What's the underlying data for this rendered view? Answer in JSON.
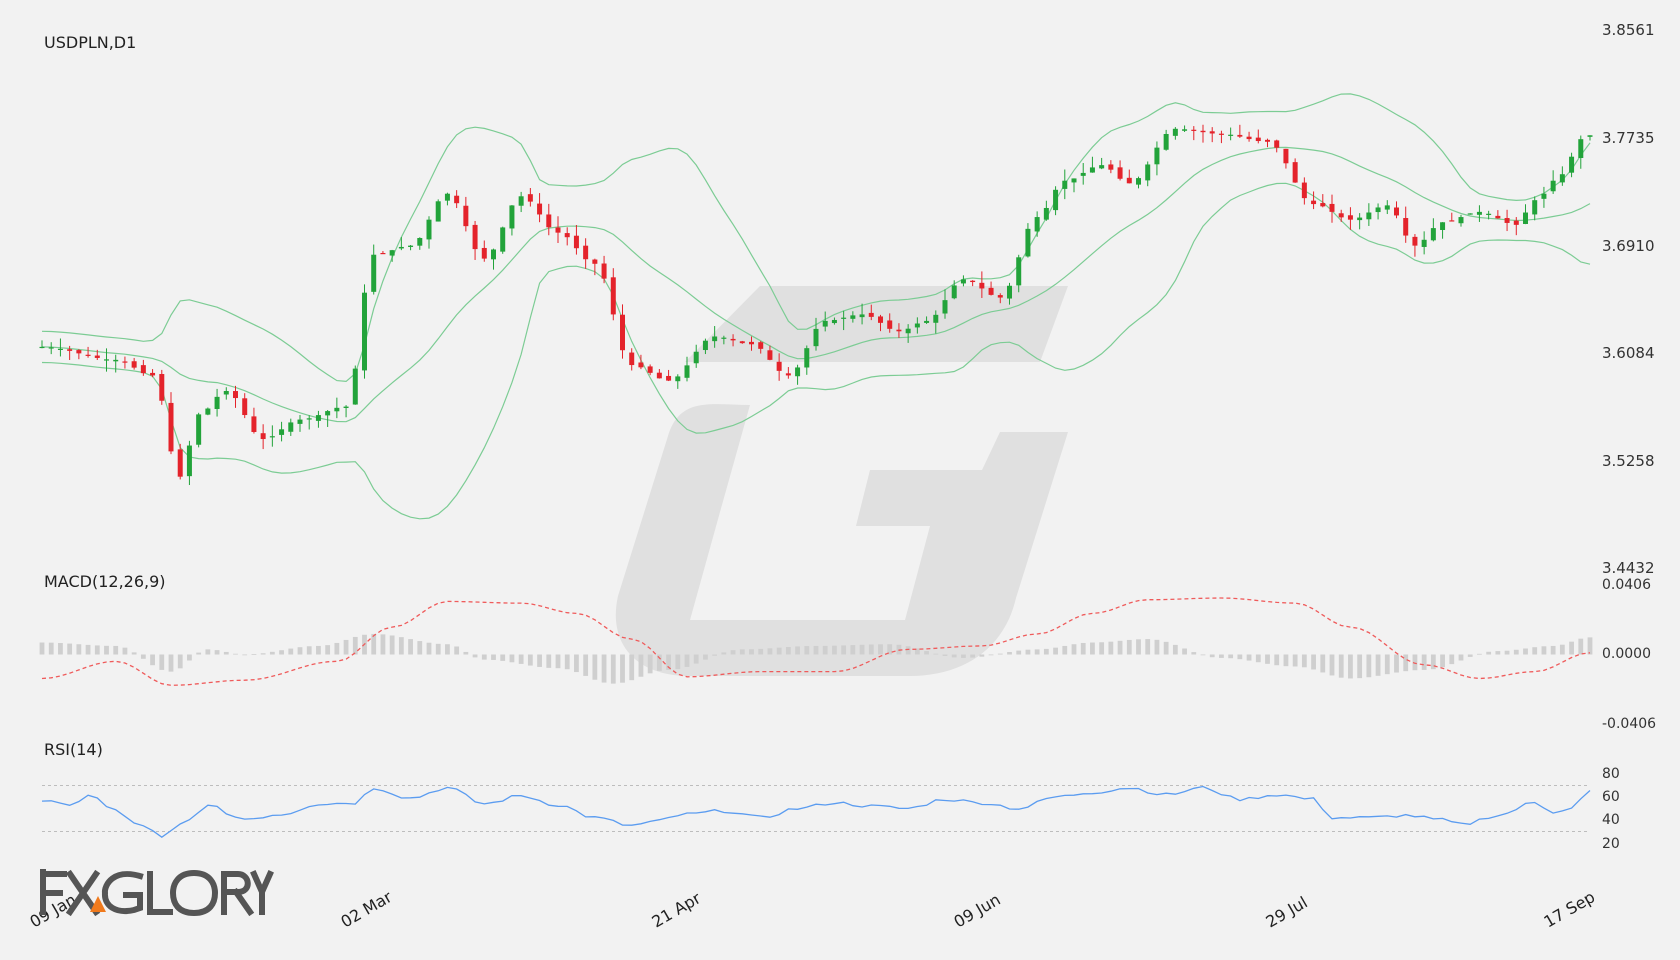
{
  "chart_data": [
    {
      "type": "candlestick",
      "title": "USDPLN,D1",
      "yticks": [
        "3.8561",
        "3.7735",
        "3.6910",
        "3.6084",
        "3.5258",
        "3.4432"
      ],
      "ylim": [
        3.4432,
        3.8561
      ],
      "x_tick_labels": [
        "09 Jan",
        "02 Mar",
        "21 Apr",
        "09 Jun",
        "29 Jul",
        "17 Sep"
      ],
      "indicators": [
        "Bollinger Bands"
      ],
      "anchors": [
        [
          0,
          3.612
        ],
        [
          8,
          3.602
        ],
        [
          12,
          3.59
        ],
        [
          15,
          3.512
        ],
        [
          17,
          3.56
        ],
        [
          20,
          3.578
        ],
        [
          24,
          3.541
        ],
        [
          28,
          3.556
        ],
        [
          33,
          3.566
        ],
        [
          36,
          3.683
        ],
        [
          40,
          3.69
        ],
        [
          44,
          3.73
        ],
        [
          48,
          3.68
        ],
        [
          52,
          3.728
        ],
        [
          56,
          3.7
        ],
        [
          60,
          3.676
        ],
        [
          64,
          3.598
        ],
        [
          68,
          3.586
        ],
        [
          73,
          3.62
        ],
        [
          77,
          3.614
        ],
        [
          81,
          3.59
        ],
        [
          85,
          3.632
        ],
        [
          89,
          3.637
        ],
        [
          93,
          3.624
        ],
        [
          96,
          3.632
        ],
        [
          100,
          3.664
        ],
        [
          104,
          3.65
        ],
        [
          108,
          3.712
        ],
        [
          111,
          3.74
        ],
        [
          115,
          3.752
        ],
        [
          118,
          3.738
        ],
        [
          123,
          3.78
        ],
        [
          128,
          3.776
        ],
        [
          133,
          3.77
        ],
        [
          138,
          3.722
        ],
        [
          142,
          3.71
        ],
        [
          146,
          3.721
        ],
        [
          149,
          3.69
        ],
        [
          152,
          3.708
        ],
        [
          156,
          3.716
        ],
        [
          160,
          3.706
        ],
        [
          162,
          3.725
        ],
        [
          165,
          3.745
        ],
        [
          167,
          3.772
        ],
        [
          168,
          3.775
        ]
      ]
    },
    {
      "type": "bar+line",
      "title": "MACD(12,26,9)",
      "yticks": [
        "0.0406",
        "0.0000",
        "-0.0406"
      ],
      "ylim": [
        -0.0406,
        0.0406
      ],
      "series": [
        {
          "name": "",
          "anchors": [
            [
              0,
              -0.014
            ],
            [
              8,
              -0.004
            ],
            [
              14,
              -0.018
            ],
            [
              22,
              -0.015
            ],
            [
              32,
              -0.004
            ],
            [
              38,
              0.016
            ],
            [
              44,
              0.031
            ],
            [
              52,
              0.03
            ],
            [
              58,
              0.024
            ],
            [
              64,
              0.009
            ],
            [
              70,
              -0.013
            ],
            [
              78,
              -0.01
            ],
            [
              86,
              -0.01
            ],
            [
              94,
              0.003
            ],
            [
              102,
              0.005
            ],
            [
              108,
              0.012
            ],
            [
              114,
              0.024
            ],
            [
              120,
              0.032
            ],
            [
              128,
              0.033
            ],
            [
              136,
              0.03
            ],
            [
              142,
              0.016
            ],
            [
              150,
              -0.006
            ],
            [
              156,
              -0.014
            ],
            [
              162,
              -0.01
            ],
            [
              168,
              0.001
            ]
          ]
        },
        {
          "name": "",
          "anchors": [
            [
              0,
              0.007
            ],
            [
              8,
              0.005
            ],
            [
              14,
              -0.01
            ],
            [
              18,
              0.003
            ],
            [
              22,
              0.0
            ],
            [
              30,
              0.005
            ],
            [
              36,
              0.012
            ],
            [
              44,
              0.006
            ],
            [
              48,
              -0.003
            ],
            [
              56,
              -0.008
            ],
            [
              62,
              -0.017
            ],
            [
              68,
              -0.009
            ],
            [
              76,
              0.003
            ],
            [
              84,
              0.005
            ],
            [
              92,
              0.006
            ],
            [
              100,
              -0.002
            ],
            [
              108,
              0.003
            ],
            [
              114,
              0.007
            ],
            [
              120,
              0.009
            ],
            [
              128,
              -0.002
            ],
            [
              136,
              -0.007
            ],
            [
              142,
              -0.014
            ],
            [
              150,
              -0.009
            ],
            [
              158,
              0.002
            ],
            [
              164,
              0.005
            ],
            [
              168,
              0.01
            ]
          ]
        }
      ]
    },
    {
      "type": "line",
      "title": "RSI(14)",
      "yticks": [
        "80",
        "60",
        "40",
        "20"
      ],
      "ylim": [
        0,
        100
      ],
      "guide_lines": [
        70,
        30
      ],
      "anchors": [
        [
          0,
          57
        ],
        [
          3,
          52
        ],
        [
          5,
          62
        ],
        [
          8,
          48
        ],
        [
          10,
          38
        ],
        [
          12,
          30
        ],
        [
          13,
          24
        ],
        [
          15,
          36
        ],
        [
          18,
          52
        ],
        [
          22,
          41
        ],
        [
          26,
          45
        ],
        [
          30,
          54
        ],
        [
          34,
          55
        ],
        [
          36,
          68
        ],
        [
          40,
          59
        ],
        [
          44,
          68
        ],
        [
          48,
          54
        ],
        [
          52,
          61
        ],
        [
          56,
          53
        ],
        [
          60,
          42
        ],
        [
          64,
          35
        ],
        [
          66,
          38
        ],
        [
          70,
          45
        ],
        [
          74,
          48
        ],
        [
          78,
          42
        ],
        [
          82,
          50
        ],
        [
          86,
          55
        ],
        [
          90,
          52
        ],
        [
          94,
          50
        ],
        [
          98,
          58
        ],
        [
          102,
          55
        ],
        [
          106,
          50
        ],
        [
          110,
          60
        ],
        [
          114,
          64
        ],
        [
          118,
          68
        ],
        [
          122,
          62
        ],
        [
          126,
          68
        ],
        [
          130,
          58
        ],
        [
          134,
          62
        ],
        [
          138,
          58
        ],
        [
          140,
          42
        ],
        [
          144,
          42
        ],
        [
          148,
          44
        ],
        [
          152,
          40
        ],
        [
          154,
          36
        ],
        [
          158,
          44
        ],
        [
          162,
          55
        ],
        [
          164,
          47
        ],
        [
          166,
          51
        ],
        [
          168,
          65
        ]
      ]
    }
  ]
}
